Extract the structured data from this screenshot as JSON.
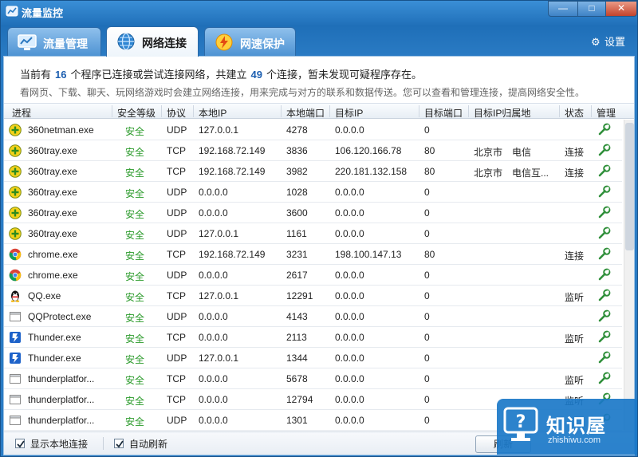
{
  "window": {
    "title": "流量监控",
    "min": "—",
    "max": "□",
    "close": "✕"
  },
  "tabs": [
    {
      "label": "流量管理",
      "active": false
    },
    {
      "label": "网络连接",
      "active": true
    },
    {
      "label": "网速保护",
      "active": false
    }
  ],
  "settings_label": "设置",
  "summary": {
    "pre": "当前有",
    "programs": "16",
    "mid": "个程序已连接或尝试连接网络，共建立",
    "connections": "49",
    "post": "个连接，暂未发现可疑程序存在。",
    "hint": "看网页、下载、聊天、玩网络游戏时会建立网络连接，用来完成与对方的联系和数据传送。您可以查看和管理连接，提高网络安全性。"
  },
  "columns": [
    "进程",
    "安全等级",
    "协议",
    "本地IP",
    "本地端口",
    "目标IP",
    "目标端口",
    "目标IP归属地",
    "状态",
    "管理"
  ],
  "rows": [
    {
      "icon": "360-icon",
      "process": "360netman.exe",
      "safety": "安全",
      "proto": "UDP",
      "lip": "127.0.0.1",
      "lport": "4278",
      "rip": "0.0.0.0",
      "rport": "0",
      "loc": "",
      "state": ""
    },
    {
      "icon": "360-icon",
      "process": "360tray.exe",
      "safety": "安全",
      "proto": "TCP",
      "lip": "192.168.72.149",
      "lport": "3836",
      "rip": "106.120.166.78",
      "rport": "80",
      "loc": "北京市　电信",
      "state": "连接"
    },
    {
      "icon": "360-icon",
      "process": "360tray.exe",
      "safety": "安全",
      "proto": "TCP",
      "lip": "192.168.72.149",
      "lport": "3982",
      "rip": "220.181.132.158",
      "rport": "80",
      "loc": "北京市　电信互...",
      "state": "连接"
    },
    {
      "icon": "360-icon",
      "process": "360tray.exe",
      "safety": "安全",
      "proto": "UDP",
      "lip": "0.0.0.0",
      "lport": "1028",
      "rip": "0.0.0.0",
      "rport": "0",
      "loc": "",
      "state": ""
    },
    {
      "icon": "360-icon",
      "process": "360tray.exe",
      "safety": "安全",
      "proto": "UDP",
      "lip": "0.0.0.0",
      "lport": "3600",
      "rip": "0.0.0.0",
      "rport": "0",
      "loc": "",
      "state": ""
    },
    {
      "icon": "360-icon",
      "process": "360tray.exe",
      "safety": "安全",
      "proto": "UDP",
      "lip": "127.0.0.1",
      "lport": "1161",
      "rip": "0.0.0.0",
      "rport": "0",
      "loc": "",
      "state": ""
    },
    {
      "icon": "chrome-icon",
      "process": "chrome.exe",
      "safety": "安全",
      "proto": "TCP",
      "lip": "192.168.72.149",
      "lport": "3231",
      "rip": "198.100.147.13",
      "rport": "80",
      "loc": "",
      "state": "连接"
    },
    {
      "icon": "chrome-icon",
      "process": "chrome.exe",
      "safety": "安全",
      "proto": "UDP",
      "lip": "0.0.0.0",
      "lport": "2617",
      "rip": "0.0.0.0",
      "rport": "0",
      "loc": "",
      "state": ""
    },
    {
      "icon": "qq-icon",
      "process": "QQ.exe",
      "safety": "安全",
      "proto": "TCP",
      "lip": "127.0.0.1",
      "lport": "12291",
      "rip": "0.0.0.0",
      "rport": "0",
      "loc": "",
      "state": "监听"
    },
    {
      "icon": "blank-app-icon",
      "process": "QQProtect.exe",
      "safety": "安全",
      "proto": "UDP",
      "lip": "0.0.0.0",
      "lport": "4143",
      "rip": "0.0.0.0",
      "rport": "0",
      "loc": "",
      "state": ""
    },
    {
      "icon": "thunder-icon",
      "process": "Thunder.exe",
      "safety": "安全",
      "proto": "TCP",
      "lip": "0.0.0.0",
      "lport": "2113",
      "rip": "0.0.0.0",
      "rport": "0",
      "loc": "",
      "state": "监听"
    },
    {
      "icon": "thunder-icon",
      "process": "Thunder.exe",
      "safety": "安全",
      "proto": "UDP",
      "lip": "127.0.0.1",
      "lport": "1344",
      "rip": "0.0.0.0",
      "rport": "0",
      "loc": "",
      "state": ""
    },
    {
      "icon": "blank-app-icon",
      "process": "thunderplatfor...",
      "safety": "安全",
      "proto": "TCP",
      "lip": "0.0.0.0",
      "lport": "5678",
      "rip": "0.0.0.0",
      "rport": "0",
      "loc": "",
      "state": "监听"
    },
    {
      "icon": "blank-app-icon",
      "process": "thunderplatfor...",
      "safety": "安全",
      "proto": "TCP",
      "lip": "0.0.0.0",
      "lport": "12794",
      "rip": "0.0.0.0",
      "rport": "0",
      "loc": "",
      "state": "监听"
    },
    {
      "icon": "blank-app-icon",
      "process": "thunderplatfor...",
      "safety": "安全",
      "proto": "UDP",
      "lip": "0.0.0.0",
      "lport": "1301",
      "rip": "0.0.0.0",
      "rport": "0",
      "loc": "",
      "state": ""
    }
  ],
  "bottom": {
    "show_local_label": "显示本地连接",
    "show_local_checked": true,
    "auto_refresh_label": "自动刷新",
    "auto_refresh_checked": true,
    "refresh_button": "刷新"
  },
  "watermark": {
    "text": "知识屋",
    "sub": "zhishiwu.com"
  },
  "colors": {
    "accent": "#1f6fb8",
    "safe": "#2a9a2a",
    "count": "#1d5fb0"
  }
}
